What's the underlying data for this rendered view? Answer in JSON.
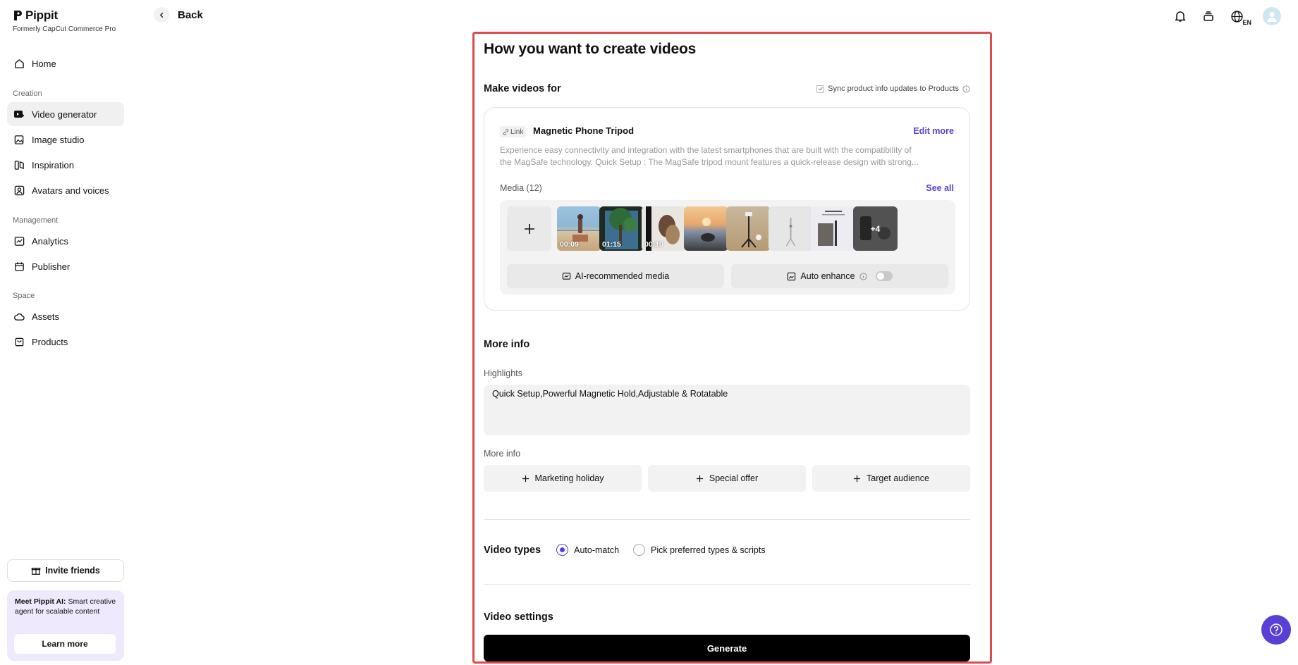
{
  "app": {
    "name": "Pippit",
    "subtitle": "Formerly CapCut Commerce Pro"
  },
  "sidebar": {
    "home": "Home",
    "sections": {
      "creation": "Creation",
      "management": "Management",
      "space": "Space"
    },
    "items": [
      {
        "label": "Video generator",
        "icon": "video-plus-icon",
        "active": true
      },
      {
        "label": "Image studio",
        "icon": "image-plus-icon"
      },
      {
        "label": "Inspiration",
        "icon": "inspiration-icon"
      },
      {
        "label": "Avatars and voices",
        "icon": "avatar-icon"
      },
      {
        "label": "Analytics",
        "icon": "chart-icon"
      },
      {
        "label": "Publisher",
        "icon": "calendar-icon"
      },
      {
        "label": "Assets",
        "icon": "cloud-icon"
      },
      {
        "label": "Products",
        "icon": "bag-icon"
      }
    ],
    "invite": "Invite friends",
    "promo": {
      "title": "Meet Pippit AI:",
      "body": "Smart creative agent for scalable content",
      "button": "Learn more"
    }
  },
  "topbar": {
    "back": "Back",
    "lang": "EN"
  },
  "main": {
    "title": "How you want to create videos",
    "make_videos_for": "Make videos for",
    "sync_label": "Sync product info updates to Products",
    "product": {
      "tag": "Link",
      "name": "Magnetic Phone Tripod",
      "edit": "Edit more",
      "desc_line1": "Experience easy connectivity and integration with the latest smartphones that are built with the compatibility of",
      "desc_line2": "the MagSafe technology. Quick Setup : The MagSafe tripod mount features a quick-release design with strong..."
    },
    "media": {
      "label": "Media (12)",
      "see_all": "See all",
      "thumbs": [
        {
          "duration": "00:09"
        },
        {
          "duration": "01:15"
        },
        {
          "duration": "00:10"
        },
        {
          "duration": ""
        },
        {
          "duration": ""
        },
        {
          "duration": ""
        },
        {
          "duration": ""
        },
        {
          "duration": "",
          "more": "+4"
        }
      ],
      "ai_recommended": "AI-recommended media",
      "auto_enhance": "Auto enhance",
      "auto_enhance_on": false
    },
    "more_info_title": "More info",
    "highlights_label": "Highlights",
    "highlights_value": "Quick Setup,Powerful Magnetic Hold,Adjustable & Rotatable",
    "more_info_label": "More info",
    "pills": [
      "Marketing holiday",
      "Special offer",
      "Target audience"
    ],
    "video_types": {
      "title": "Video types",
      "options": [
        "Auto-match",
        "Pick preferred types & scripts"
      ],
      "selected": "Auto-match"
    },
    "video_settings": "Video settings",
    "generate": "Generate"
  },
  "colors": {
    "accent": "#5a3fd6",
    "highlight_border": "#e04a4a"
  }
}
